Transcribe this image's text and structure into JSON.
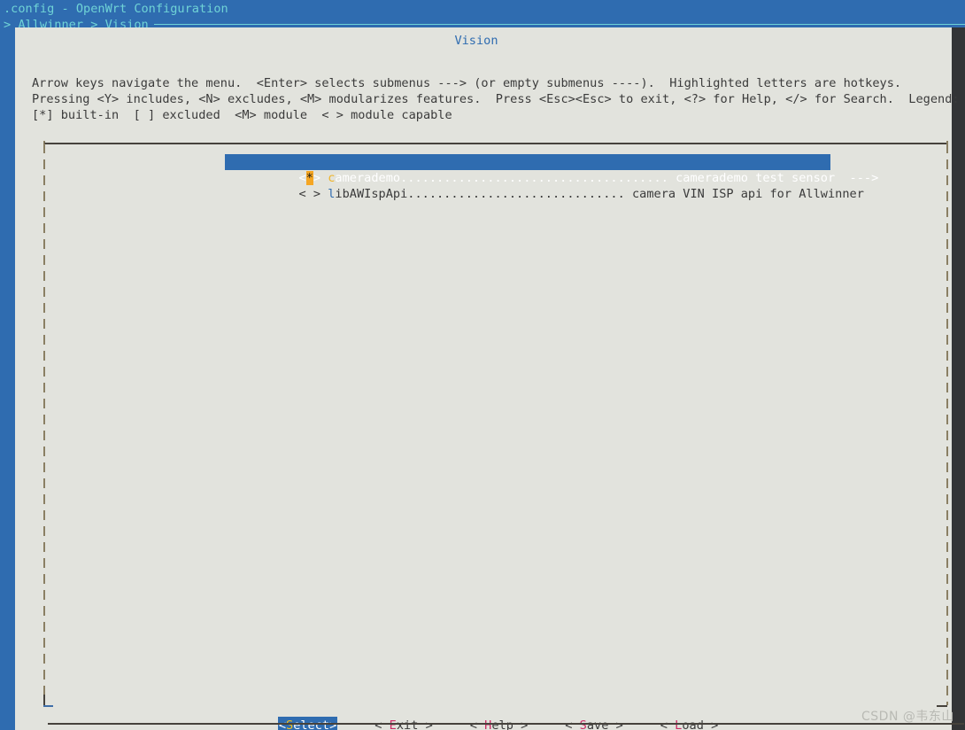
{
  "header": {
    "title": ".config - OpenWrt Configuration",
    "breadcrumb": "> Allwinner > Vision"
  },
  "dialog": {
    "title": "Vision",
    "help_lines": [
      "Arrow keys navigate the menu.  <Enter> selects submenus ---> (or empty submenus ----).  Highlighted letters are hotkeys.",
      "Pressing <Y> includes, <N> excludes, <M> modularizes features.  Press <Esc><Esc> to exit, <?> for Help, </> for Search.  Legend:",
      "[*] built-in  [ ] excluded  <M> module  < > module capable"
    ]
  },
  "menu": {
    "items": [
      {
        "selected": true,
        "open_bracket": "<",
        "mark": "*",
        "close_bracket": ">",
        "hotkey": "c",
        "label_rest": "amerademo",
        "dots": ".....................................",
        "description": "camerademo test sensor  --->"
      },
      {
        "selected": false,
        "open_bracket": "<",
        "mark": " ",
        "close_bracket": ">",
        "hotkey": "l",
        "label_rest": "ibAWIspApi",
        "dots": "..............................",
        "description": "camera VIN ISP api for Allwinner"
      }
    ]
  },
  "buttons": [
    {
      "active": true,
      "open": "<",
      "hotkey": "S",
      "rest": "elect",
      "close": ">"
    },
    {
      "active": false,
      "open": "< ",
      "hotkey": "E",
      "rest": "xit",
      "close": " >"
    },
    {
      "active": false,
      "open": "< ",
      "hotkey": "H",
      "rest": "elp",
      "close": " >"
    },
    {
      "active": false,
      "open": "< ",
      "hotkey": "S",
      "rest": "ave",
      "close": " >"
    },
    {
      "active": false,
      "open": "< ",
      "hotkey": "L",
      "rest": "oad",
      "close": " >"
    }
  ],
  "watermark": "CSDN @韦东山",
  "colors": {
    "terminal_blue": "#2f6cb0",
    "dialog_bg": "#e2e3dd",
    "header_cyan": "#6fd3d6",
    "mark_orange": "#f5a623",
    "hotkey_magenta": "#cc2a63",
    "gutter_dark": "#333436"
  }
}
